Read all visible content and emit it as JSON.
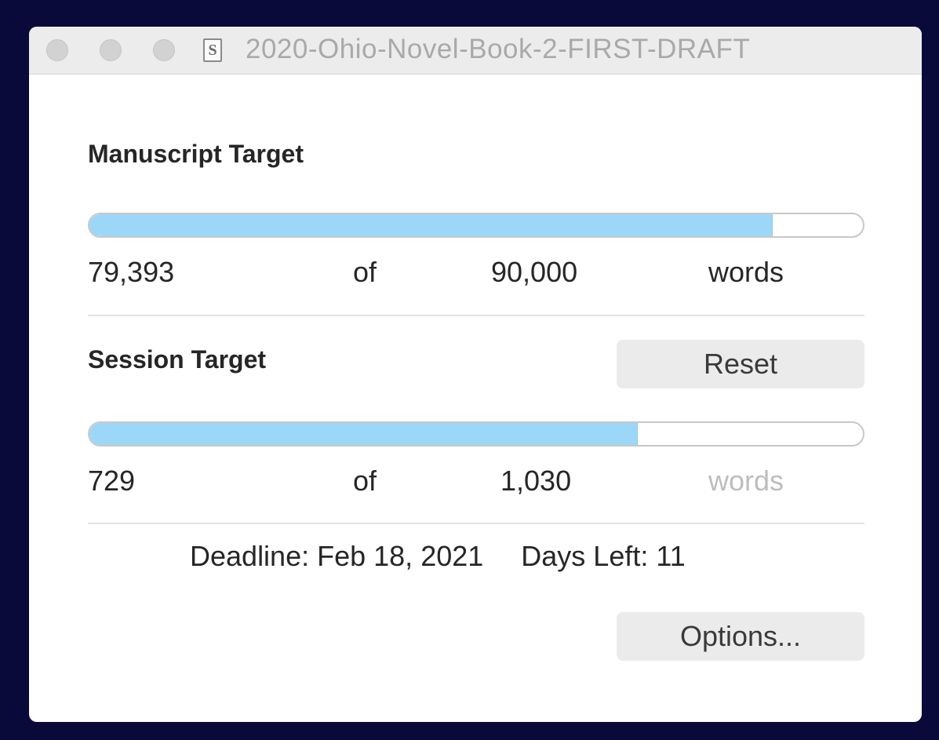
{
  "window": {
    "title": "2020-Ohio-Novel-Book-2-FIRST-DRAFT",
    "doc_icon_glyph": "S"
  },
  "manuscript": {
    "heading": "Manuscript Target",
    "current": "79,393",
    "of_label": "of",
    "target": "90,000",
    "unit": "words",
    "progress": 0.882
  },
  "session": {
    "heading": "Session Target",
    "reset_label": "Reset",
    "current": "729",
    "of_label": "of",
    "target": "1,030",
    "unit": "words",
    "progress": 0.708
  },
  "deadline": {
    "date_text": "Deadline: Feb 18, 2021",
    "days_left_text": "Days Left: 11"
  },
  "options_label": "Options...",
  "colors": {
    "progress_fill": "#9dd7f7",
    "background": "#0a0a3a"
  }
}
